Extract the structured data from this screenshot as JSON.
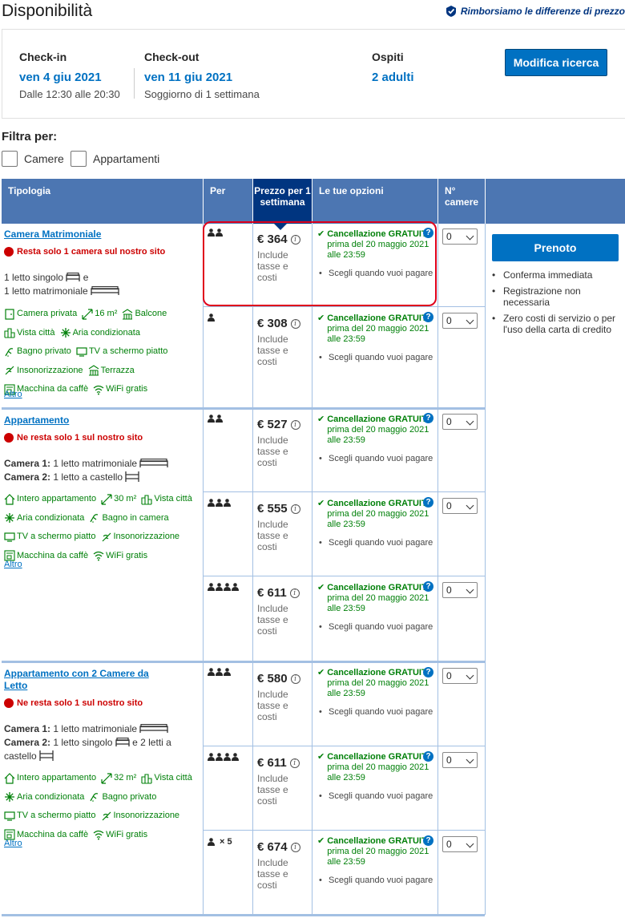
{
  "page_title": "Disponibilità",
  "price_match": "Rimborsiamo le differenze di prezzo",
  "search": {
    "checkin_label": "Check-in",
    "checkin_date": "ven 4 giu 2021",
    "checkin_time": "Dalle 12:30 alle 20:30",
    "checkout_label": "Check-out",
    "checkout_date": "ven 11 giu 2021",
    "stay_length": "Soggiorno di 1 settimana",
    "guests_label": "Ospiti",
    "guests_value": "2 adulti",
    "modify_button": "Modifica ricerca"
  },
  "filters": {
    "title": "Filtra per:",
    "options": [
      "Camere",
      "Appartamenti"
    ]
  },
  "table_headers": {
    "type": "Tipologia",
    "per": "Per",
    "price": "Prezzo per 1 settimana",
    "options": "Le tue opzioni",
    "rooms": "N° camere"
  },
  "common": {
    "includes": "Include tasse e costi",
    "cancel_label": "Cancellazione",
    "free": "GRATUITA",
    "cancel_rest": "prima del 20 maggio 2021 alle 23:59",
    "pay_choice": "Scegli quando vuoi pagare",
    "qty_default": "0",
    "more": "Altro",
    "times": "× 5"
  },
  "rooms": [
    {
      "name": "Camera Matrimoniale",
      "scarcity": "Resta solo 1 camera sul nostro sito",
      "beds_line1": "1 letto singolo",
      "beds_and": "e",
      "beds_line2": "1 letto matrimoniale",
      "facilities": [
        "Camera privata",
        "16 m²",
        "Balcone",
        "Vista città",
        "Aria condizionata",
        "Bagno privato",
        "TV a schermo piatto",
        "Insonorizzazione",
        "Terrazza",
        "Macchina da caffè",
        "WiFi gratis"
      ],
      "prices": [
        "€ 364",
        "€ 308"
      ]
    },
    {
      "name": "Appartamento",
      "scarcity": "Ne resta solo 1 sul nostro sito",
      "bed_room1_label": "Camera 1:",
      "bed_room1": "1 letto matrimoniale",
      "bed_room2_label": "Camera 2:",
      "bed_room2": "1 letto a castello",
      "facilities": [
        "Intero appartamento",
        "30 m²",
        "Vista città",
        "Aria condizionata",
        "Bagno in camera",
        "TV a schermo piatto",
        "Insonorizzazione",
        "Macchina da caffè",
        "WiFi gratis"
      ],
      "prices": [
        "€ 527",
        "€ 555",
        "€ 611"
      ]
    },
    {
      "name": "Appartamento con 2 Camere da Letto",
      "scarcity": "Ne resta solo 1 sul nostro sito",
      "bed_room1_label": "Camera 1:",
      "bed_room1": "1 letto matrimoniale",
      "bed_room2_label": "Camera 2:",
      "bed_room2_a": "1 letto singolo",
      "bed_room2_b": "e 2 letti a castello",
      "facilities": [
        "Intero appartamento",
        "32 m²",
        "Vista città",
        "Aria condizionata",
        "Bagno privato",
        "TV a schermo piatto",
        "Insonorizzazione",
        "Macchina da caffè",
        "WiFi gratis"
      ],
      "prices": [
        "€ 580",
        "€ 611",
        "€ 674"
      ]
    }
  ],
  "reserve": {
    "button": "Prenoto",
    "benefits": [
      "Conferma immediata",
      "Registrazione non necessaria",
      "Zero costi di servizio o per l'uso della carta di credito"
    ]
  },
  "colors": {
    "brand_dark": "#003580",
    "brand_blue": "#0071c2",
    "header_blue": "#4c76b2",
    "green": "#008009",
    "red": "#cc0000"
  }
}
